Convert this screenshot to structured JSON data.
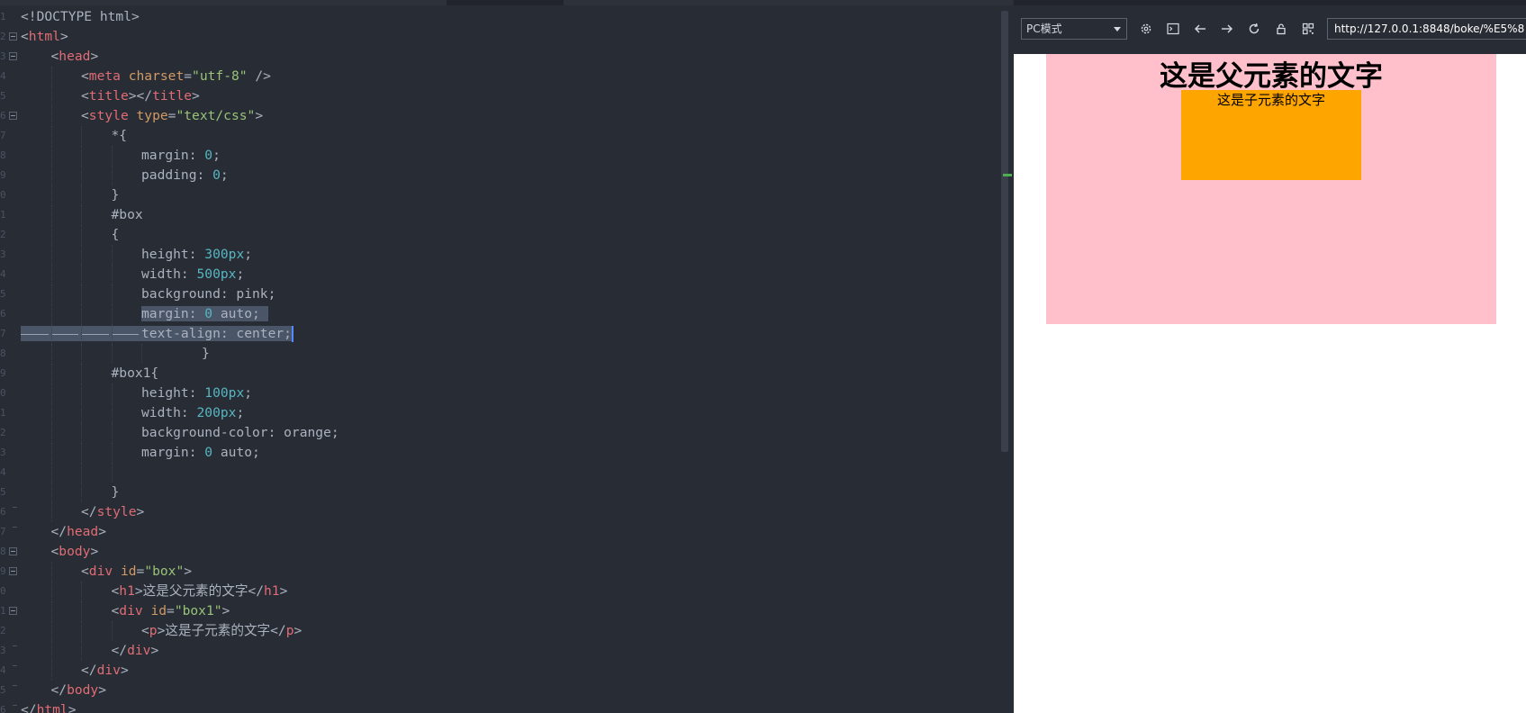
{
  "editor": {
    "lines": [
      {
        "ind": 0,
        "fold": "none",
        "toks": [
          [
            "txt",
            "<!DOCTYPE html>"
          ]
        ]
      },
      {
        "ind": 0,
        "fold": "open",
        "toks": [
          [
            "txt",
            "<"
          ],
          [
            "tag",
            "html"
          ],
          [
            "txt",
            ">"
          ]
        ]
      },
      {
        "ind": 1,
        "fold": "open",
        "toks": [
          [
            "txt",
            "<"
          ],
          [
            "tag",
            "head"
          ],
          [
            "txt",
            ">"
          ]
        ]
      },
      {
        "ind": 2,
        "fold": "none",
        "toks": [
          [
            "txt",
            "<"
          ],
          [
            "tag",
            "meta "
          ],
          [
            "attr",
            "charset"
          ],
          [
            "txt",
            "="
          ],
          [
            "str",
            "\"utf-8\""
          ],
          [
            "txt",
            " />"
          ]
        ]
      },
      {
        "ind": 2,
        "fold": "none",
        "toks": [
          [
            "txt",
            "<"
          ],
          [
            "tag",
            "title"
          ],
          [
            "txt",
            "></"
          ],
          [
            "tag",
            "title"
          ],
          [
            "txt",
            ">"
          ]
        ]
      },
      {
        "ind": 2,
        "fold": "open",
        "toks": [
          [
            "txt",
            "<"
          ],
          [
            "tag",
            "style "
          ],
          [
            "attr",
            "type"
          ],
          [
            "txt",
            "="
          ],
          [
            "str",
            "\"text/css\""
          ],
          [
            "txt",
            ">"
          ]
        ]
      },
      {
        "ind": 3,
        "fold": "none",
        "toks": [
          [
            "txt",
            "*{"
          ]
        ]
      },
      {
        "ind": 4,
        "fold": "none",
        "toks": [
          [
            "txt",
            "margin: "
          ],
          [
            "num",
            "0"
          ],
          [
            "txt",
            ";"
          ]
        ]
      },
      {
        "ind": 4,
        "fold": "none",
        "toks": [
          [
            "txt",
            "padding: "
          ],
          [
            "num",
            "0"
          ],
          [
            "txt",
            ";"
          ]
        ]
      },
      {
        "ind": 3,
        "fold": "none",
        "toks": [
          [
            "txt",
            "}"
          ]
        ]
      },
      {
        "ind": 3,
        "fold": "none",
        "toks": [
          [
            "txt",
            "#box"
          ]
        ]
      },
      {
        "ind": 3,
        "fold": "none",
        "toks": [
          [
            "txt",
            "{"
          ]
        ]
      },
      {
        "ind": 4,
        "fold": "none",
        "toks": [
          [
            "txt",
            "height: "
          ],
          [
            "num",
            "300px"
          ],
          [
            "txt",
            ";"
          ]
        ]
      },
      {
        "ind": 4,
        "fold": "none",
        "toks": [
          [
            "txt",
            "width: "
          ],
          [
            "num",
            "500px"
          ],
          [
            "txt",
            ";"
          ]
        ]
      },
      {
        "ind": 4,
        "fold": "none",
        "toks": [
          [
            "txt",
            "background: pink;"
          ]
        ]
      },
      {
        "ind": 4,
        "fold": "none",
        "sel": "text",
        "toks": [
          [
            "txt",
            "margin: "
          ],
          [
            "num",
            "0"
          ],
          [
            "txt",
            " auto; "
          ]
        ]
      },
      {
        "ind": 4,
        "fold": "none",
        "sel": "full",
        "toks": [
          [
            "txt",
            "text-align: center;"
          ]
        ]
      },
      {
        "ind": 6,
        "fold": "none",
        "toks": [
          [
            "txt",
            "}"
          ]
        ]
      },
      {
        "ind": 3,
        "fold": "none",
        "toks": [
          [
            "txt",
            "#box1{"
          ]
        ]
      },
      {
        "ind": 4,
        "fold": "none",
        "toks": [
          [
            "txt",
            "height: "
          ],
          [
            "num",
            "100px"
          ],
          [
            "txt",
            ";"
          ]
        ]
      },
      {
        "ind": 4,
        "fold": "none",
        "toks": [
          [
            "txt",
            "width: "
          ],
          [
            "num",
            "200px"
          ],
          [
            "txt",
            ";"
          ]
        ]
      },
      {
        "ind": 4,
        "fold": "none",
        "toks": [
          [
            "txt",
            "background-color: orange;"
          ]
        ]
      },
      {
        "ind": 4,
        "fold": "none",
        "toks": [
          [
            "txt",
            "margin: "
          ],
          [
            "num",
            "0"
          ],
          [
            "txt",
            " auto;"
          ]
        ]
      },
      {
        "ind": 4,
        "fold": "none",
        "toks": []
      },
      {
        "ind": 3,
        "fold": "none",
        "toks": [
          [
            "txt",
            "}"
          ]
        ]
      },
      {
        "ind": 2,
        "fold": "end",
        "toks": [
          [
            "txt",
            "</"
          ],
          [
            "tag",
            "style"
          ],
          [
            "txt",
            ">"
          ]
        ]
      },
      {
        "ind": 1,
        "fold": "end",
        "toks": [
          [
            "txt",
            "</"
          ],
          [
            "tag",
            "head"
          ],
          [
            "txt",
            ">"
          ]
        ]
      },
      {
        "ind": 1,
        "fold": "open",
        "toks": [
          [
            "txt",
            "<"
          ],
          [
            "tag",
            "body"
          ],
          [
            "txt",
            ">"
          ]
        ]
      },
      {
        "ind": 2,
        "fold": "open",
        "toks": [
          [
            "txt",
            "<"
          ],
          [
            "tag",
            "div "
          ],
          [
            "attr",
            "id"
          ],
          [
            "txt",
            "="
          ],
          [
            "str",
            "\"box\""
          ],
          [
            "txt",
            ">"
          ]
        ]
      },
      {
        "ind": 3,
        "fold": "none",
        "toks": [
          [
            "txt",
            "<"
          ],
          [
            "tag",
            "h1"
          ],
          [
            "txt",
            ">这是父元素的文字</"
          ],
          [
            "tag",
            "h1"
          ],
          [
            "txt",
            ">"
          ]
        ]
      },
      {
        "ind": 3,
        "fold": "open",
        "toks": [
          [
            "txt",
            "<"
          ],
          [
            "tag",
            "div "
          ],
          [
            "attr",
            "id"
          ],
          [
            "txt",
            "="
          ],
          [
            "str",
            "\"box1\""
          ],
          [
            "txt",
            ">"
          ]
        ]
      },
      {
        "ind": 4,
        "fold": "none",
        "toks": [
          [
            "txt",
            "<"
          ],
          [
            "tag",
            "p"
          ],
          [
            "txt",
            ">这是子元素的文字</"
          ],
          [
            "tag",
            "p"
          ],
          [
            "txt",
            ">"
          ]
        ]
      },
      {
        "ind": 3,
        "fold": "end",
        "toks": [
          [
            "txt",
            "</"
          ],
          [
            "tag",
            "div"
          ],
          [
            "txt",
            ">"
          ]
        ]
      },
      {
        "ind": 2,
        "fold": "end",
        "toks": [
          [
            "txt",
            "</"
          ],
          [
            "tag",
            "div"
          ],
          [
            "txt",
            ">"
          ]
        ]
      },
      {
        "ind": 1,
        "fold": "end",
        "toks": [
          [
            "txt",
            "</"
          ],
          [
            "tag",
            "body"
          ],
          [
            "txt",
            ">"
          ]
        ]
      },
      {
        "ind": 0,
        "fold": "end",
        "toks": [
          [
            "txt",
            "</"
          ],
          [
            "tag",
            "html"
          ],
          [
            "txt",
            ">"
          ]
        ]
      }
    ],
    "colors": {
      "tag": "#e06c75",
      "attr": "#d19a66",
      "str": "#98c379",
      "num": "#56b6c2",
      "text": "#abb2bf",
      "background": "#282c34"
    }
  },
  "preview": {
    "mode_select": "PC模式",
    "toolbar_icons": [
      "settings-icon",
      "terminal-icon",
      "back-arrow-icon",
      "forward-arrow-icon",
      "reload-icon",
      "lock-icon",
      "qrcode-icon"
    ],
    "url": "http://127.0.0.1:8848/boke/%E5%8",
    "page": {
      "h1": "这是父元素的文字",
      "p": "这是子元素的文字",
      "box_color": "pink",
      "box1_color": "orange"
    }
  }
}
